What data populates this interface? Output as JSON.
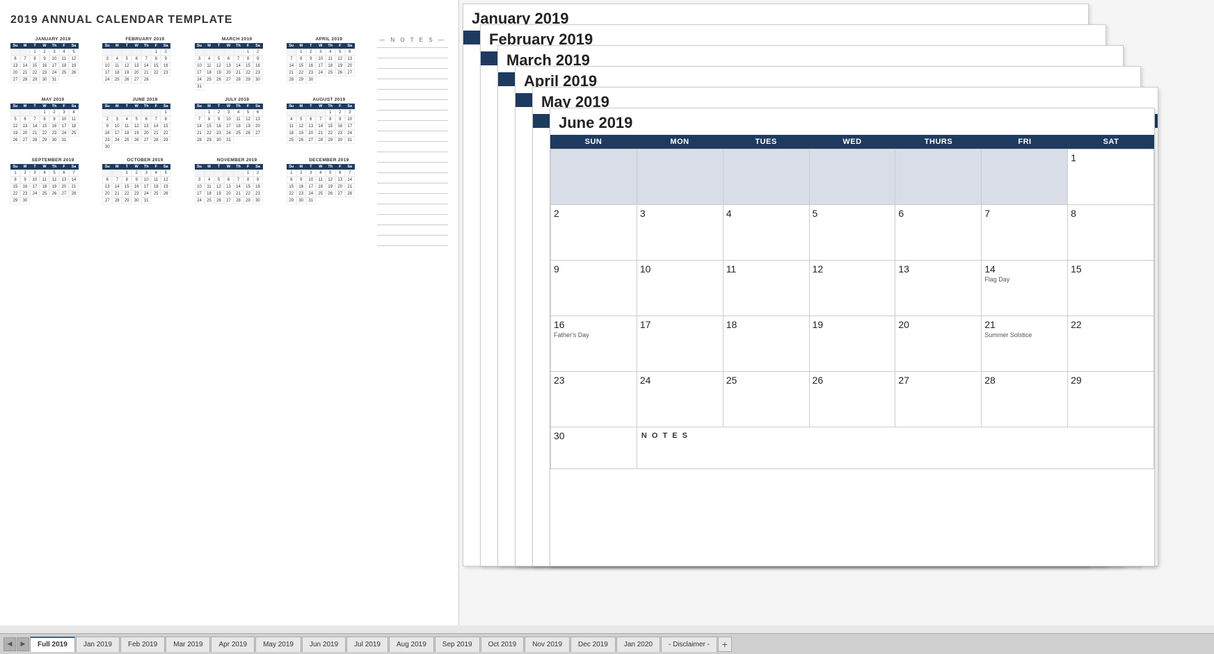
{
  "title": "2019 ANNUAL CALENDAR TEMPLATE",
  "months": [
    {
      "name": "JANUARY 2019",
      "headers": [
        "Su",
        "M",
        "T",
        "W",
        "Th",
        "F",
        "Sa"
      ],
      "days": [
        "",
        "1",
        "2",
        "3",
        "4",
        "5",
        "6",
        "7",
        "8",
        "9",
        "10",
        "11",
        "12",
        "13",
        "14",
        "15",
        "16",
        "17",
        "18",
        "19",
        "20",
        "21",
        "22",
        "23",
        "24",
        "25",
        "26",
        "27",
        "28",
        "29",
        "30",
        "31"
      ]
    },
    {
      "name": "FEBRUARY 2019",
      "headers": [
        "Su",
        "M",
        "T",
        "W",
        "Th",
        "F",
        "Sa"
      ],
      "days": [
        "",
        "",
        "",
        "",
        "",
        "1",
        "2",
        "3",
        "4",
        "5",
        "6",
        "7",
        "8",
        "9",
        "10",
        "11",
        "12",
        "13",
        "14",
        "15",
        "16",
        "17",
        "18",
        "19",
        "20",
        "21",
        "22",
        "23",
        "24",
        "25",
        "26",
        "27",
        "28"
      ]
    },
    {
      "name": "MARCH 2019",
      "headers": [
        "Su",
        "M",
        "T",
        "W",
        "Th",
        "F",
        "Sa"
      ],
      "days": [
        "",
        "",
        "",
        "",
        "",
        "1",
        "2",
        "3",
        "4",
        "5",
        "6",
        "7",
        "8",
        "9",
        "10",
        "11",
        "12",
        "13",
        "14",
        "15",
        "16",
        "17",
        "18",
        "19",
        "20",
        "21",
        "22",
        "23",
        "24",
        "25",
        "26",
        "27",
        "28",
        "29",
        "30",
        "31"
      ]
    },
    {
      "name": "APRIL 2019",
      "headers": [
        "Su",
        "M",
        "T",
        "W",
        "Th",
        "F",
        "Sa"
      ],
      "days": [
        "",
        "1",
        "2",
        "3",
        "4",
        "5",
        "6",
        "7",
        "8",
        "9",
        "10",
        "11",
        "12",
        "13",
        "14",
        "15",
        "16",
        "17",
        "18",
        "19",
        "20",
        "21",
        "22",
        "23",
        "24",
        "25",
        "26",
        "27",
        "28",
        "29",
        "30"
      ]
    },
    {
      "name": "MAY 2019",
      "headers": [
        "Su",
        "M",
        "T",
        "W",
        "Th",
        "F",
        "Sa"
      ],
      "days": [
        "",
        "",
        "",
        "1",
        "2",
        "3",
        "4",
        "5",
        "6",
        "7",
        "8",
        "9",
        "10",
        "11",
        "12",
        "13",
        "14",
        "15",
        "16",
        "17",
        "18",
        "19",
        "20",
        "21",
        "22",
        "23",
        "24",
        "25",
        "26",
        "27",
        "28",
        "29",
        "30",
        "31"
      ]
    },
    {
      "name": "JUNE 2019",
      "headers": [
        "Su",
        "M",
        "T",
        "W",
        "Th",
        "F",
        "Sa"
      ],
      "days": [
        "",
        "",
        "",
        "",
        "",
        "",
        "1",
        "2",
        "3",
        "4",
        "5",
        "6",
        "7",
        "8",
        "9",
        "10",
        "11",
        "12",
        "13",
        "14",
        "15",
        "16",
        "17",
        "18",
        "19",
        "20",
        "21",
        "22",
        "23",
        "24",
        "25",
        "26",
        "27",
        "28",
        "29",
        "30"
      ]
    },
    {
      "name": "JULY 2019",
      "headers": [
        "Su",
        "M",
        "T",
        "W",
        "Th",
        "F",
        "Sa"
      ],
      "days": [
        "",
        "1",
        "2",
        "3",
        "4",
        "5",
        "6",
        "7",
        "8",
        "9",
        "10",
        "11",
        "12",
        "13",
        "14",
        "15",
        "16",
        "17",
        "18",
        "19",
        "20",
        "21",
        "22",
        "23",
        "24",
        "25",
        "26",
        "27",
        "28",
        "29",
        "30",
        "31"
      ]
    },
    {
      "name": "AUGUST 2019",
      "headers": [
        "Su",
        "M",
        "T",
        "W",
        "Th",
        "F",
        "Sa"
      ],
      "days": [
        "",
        "",
        "",
        "",
        "1",
        "2",
        "3",
        "4",
        "5",
        "6",
        "7",
        "8",
        "9",
        "10",
        "11",
        "12",
        "13",
        "14",
        "15",
        "16",
        "17",
        "18",
        "19",
        "20",
        "21",
        "22",
        "23",
        "24",
        "25",
        "26",
        "27",
        "28",
        "29",
        "30",
        "31"
      ]
    },
    {
      "name": "SEPTEMBER 2019",
      "headers": [
        "Su",
        "M",
        "T",
        "W",
        "Th",
        "F",
        "Sa"
      ],
      "days": [
        "1",
        "2",
        "3",
        "4",
        "5",
        "6",
        "7",
        "8",
        "9",
        "10",
        "11",
        "12",
        "13",
        "14",
        "15",
        "16",
        "17",
        "18",
        "19",
        "20",
        "21",
        "22",
        "23",
        "24",
        "25",
        "26",
        "27",
        "28",
        "29",
        "30"
      ]
    },
    {
      "name": "OCTOBER 2019",
      "headers": [
        "Su",
        "M",
        "T",
        "W",
        "Th",
        "F",
        "Sa"
      ],
      "days": [
        "",
        "",
        "1",
        "2",
        "3",
        "4",
        "5",
        "6",
        "7",
        "8",
        "9",
        "10",
        "11",
        "12",
        "13",
        "14",
        "15",
        "16",
        "17",
        "18",
        "19",
        "20",
        "21",
        "22",
        "23",
        "24",
        "25",
        "26",
        "27",
        "28",
        "29",
        "30",
        "31"
      ]
    },
    {
      "name": "NOVEMBER 2019",
      "headers": [
        "Su",
        "M",
        "T",
        "W",
        "Th",
        "F",
        "Sa"
      ],
      "days": [
        "",
        "",
        "",
        "",
        "",
        "1",
        "2",
        "3",
        "4",
        "5",
        "6",
        "7",
        "8",
        "9",
        "10",
        "11",
        "12",
        "13",
        "14",
        "15",
        "16",
        "17",
        "18",
        "19",
        "20",
        "21",
        "22",
        "23",
        "24",
        "25",
        "26",
        "27",
        "28",
        "29",
        "30"
      ]
    },
    {
      "name": "DECEMBER 2019",
      "headers": [
        "Su",
        "M",
        "T",
        "W",
        "Th",
        "F",
        "Sa"
      ],
      "days": [
        "1",
        "2",
        "3",
        "4",
        "5",
        "6",
        "7",
        "8",
        "9",
        "10",
        "11",
        "12",
        "13",
        "14",
        "15",
        "16",
        "17",
        "18",
        "19",
        "20",
        "21",
        "22",
        "23",
        "24",
        "25",
        "26",
        "27",
        "28",
        "29",
        "30",
        "31"
      ]
    }
  ],
  "june_full": {
    "title": "June 2019",
    "headers": [
      "SUN",
      "MON",
      "TUES",
      "WED",
      "THURS",
      "FRI",
      "SAT"
    ],
    "weeks": [
      [
        {
          "num": "",
          "note": "",
          "empty": true
        },
        {
          "num": "",
          "note": "",
          "empty": true
        },
        {
          "num": "",
          "note": "",
          "empty": true
        },
        {
          "num": "",
          "note": "",
          "empty": true
        },
        {
          "num": "",
          "note": "",
          "empty": true
        },
        {
          "num": "",
          "note": "",
          "empty": true
        },
        {
          "num": "1",
          "note": ""
        }
      ],
      [
        {
          "num": "2",
          "note": ""
        },
        {
          "num": "3",
          "note": ""
        },
        {
          "num": "4",
          "note": ""
        },
        {
          "num": "5",
          "note": ""
        },
        {
          "num": "6",
          "note": ""
        },
        {
          "num": "7",
          "note": ""
        },
        {
          "num": "8",
          "note": ""
        }
      ],
      [
        {
          "num": "9",
          "note": ""
        },
        {
          "num": "10",
          "note": ""
        },
        {
          "num": "11",
          "note": ""
        },
        {
          "num": "12",
          "note": ""
        },
        {
          "num": "13",
          "note": ""
        },
        {
          "num": "14",
          "note": "Flag Day"
        },
        {
          "num": "15",
          "note": ""
        }
      ],
      [
        {
          "num": "16",
          "note": ""
        },
        {
          "num": "17",
          "note": ""
        },
        {
          "num": "18",
          "note": ""
        },
        {
          "num": "19",
          "note": ""
        },
        {
          "num": "20",
          "note": ""
        },
        {
          "num": "21",
          "note": "Summer Solstice"
        },
        {
          "num": "22",
          "note": ""
        }
      ],
      [
        {
          "num": "23",
          "note": ""
        },
        {
          "num": "24",
          "note": ""
        },
        {
          "num": "25",
          "note": ""
        },
        {
          "num": "26",
          "note": ""
        },
        {
          "num": "27",
          "note": ""
        },
        {
          "num": "28",
          "note": ""
        },
        {
          "num": "29",
          "note": ""
        }
      ]
    ],
    "last_row": [
      {
        "num": "30",
        "note": ""
      },
      {
        "num": "NOTES",
        "colspan": 6,
        "note": ""
      }
    ],
    "special": {
      "fathers_day": "Father's Day",
      "flag_day": "Flag Day",
      "summer_solstice": "Summer Solstice"
    }
  },
  "tabs": [
    {
      "label": "Full 2019",
      "active": true
    },
    {
      "label": "Jan 2019",
      "active": false
    },
    {
      "label": "Feb 2019",
      "active": false
    },
    {
      "label": "Mar 2019",
      "active": false
    },
    {
      "label": "Apr 2019",
      "active": false
    },
    {
      "label": "May 2019",
      "active": false
    },
    {
      "label": "Jun 2019",
      "active": false
    },
    {
      "label": "Jul 2019",
      "active": false
    },
    {
      "label": "Aug 2019",
      "active": false
    },
    {
      "label": "Sep 2019",
      "active": false
    },
    {
      "label": "Oct 2019",
      "active": false
    },
    {
      "label": "Nov 2019",
      "active": false
    },
    {
      "label": "Dec 2019",
      "active": false
    },
    {
      "label": "Jan 2020",
      "active": false
    },
    {
      "label": "- Disclaimer -",
      "active": false
    }
  ],
  "notes_label": "— N O T E S —",
  "stacked_titles": [
    "January 2019",
    "February 2019",
    "March 2019",
    "April 2019",
    "May 2019",
    "June 2019"
  ],
  "col_headers": [
    "SUN",
    "MON",
    "TUES",
    "WED",
    "THURS",
    "FRI",
    "SAT"
  ]
}
